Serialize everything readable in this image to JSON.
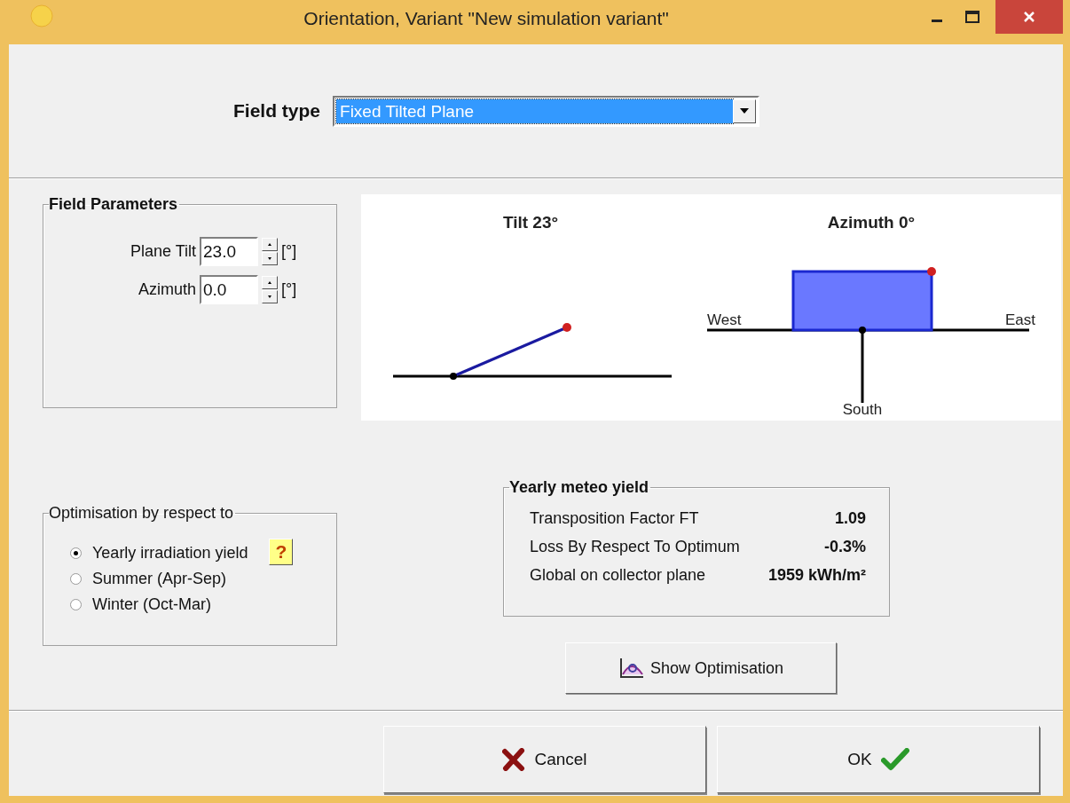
{
  "window": {
    "title": "Orientation, Variant \"New simulation variant\""
  },
  "field_type": {
    "label": "Field type",
    "value": "Fixed Tilted Plane"
  },
  "field_parameters": {
    "title": "Field Parameters",
    "fields": [
      {
        "label": "Plane Tilt",
        "value": "23.0",
        "unit": "[°]"
      },
      {
        "label": "Azimuth",
        "value": "0.0",
        "unit": "[°]"
      }
    ]
  },
  "diagram": {
    "tilt_title": "Tilt 23°",
    "azimuth_title": "Azimuth 0°",
    "west": "West",
    "east": "East",
    "south": "South"
  },
  "optimisation": {
    "title": "Optimisation by respect to",
    "help": "?",
    "options": [
      {
        "label": "Yearly irradiation yield",
        "selected": true
      },
      {
        "label": "Summer (Apr-Sep)",
        "selected": false
      },
      {
        "label": "Winter (Oct-Mar)",
        "selected": false
      }
    ]
  },
  "yield": {
    "title": "Yearly meteo yield",
    "rows": [
      {
        "label": "Transposition Factor FT",
        "value": "1.09"
      },
      {
        "label": "Loss By Respect To Optimum",
        "value": "-0.3%"
      },
      {
        "label": "Global on collector plane",
        "value": "1959 kWh/m²"
      }
    ]
  },
  "show_optimisation": {
    "label": "Show Optimisation"
  },
  "buttons": [
    {
      "kind": "cancel",
      "label": "Cancel"
    },
    {
      "kind": "ok",
      "label": "OK"
    }
  ]
}
